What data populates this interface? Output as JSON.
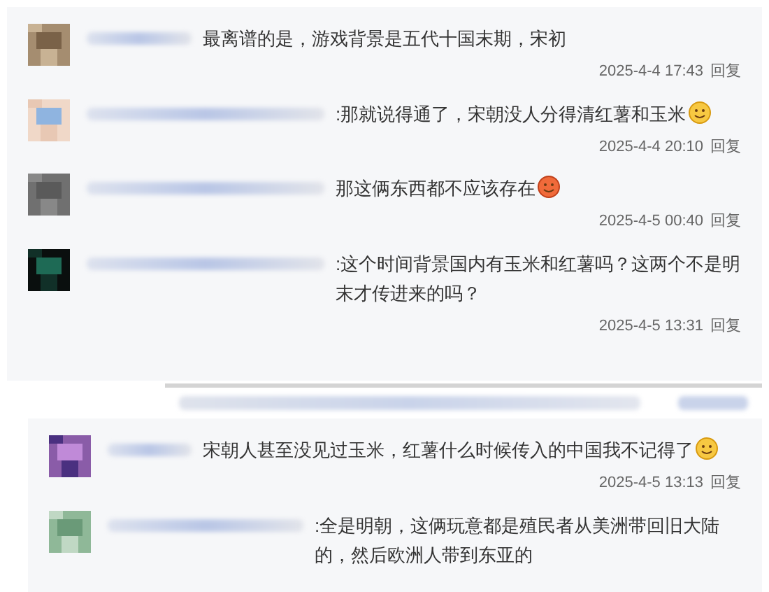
{
  "sections": [
    {
      "comments": [
        {
          "text": "最离谱的是，游戏背景是五代十国末期，宋初",
          "time": "2025-4-4 17:43",
          "reply": "回复"
        },
        {
          "text": ":那就说得通了，宋朝没人分得清红薯和玉米",
          "emoji": {
            "kind": "smile"
          },
          "time": "2025-4-4 20:10",
          "reply": "回复"
        },
        {
          "text": "那这俩东西都不应该存在",
          "emoji": {
            "kind": "angry"
          },
          "time": "2025-4-5 00:40",
          "reply": "回复"
        },
        {
          "text": ":这个时间背景国内有玉米和红薯吗？这两个不是明末才传进来的吗？",
          "time": "2025-4-5 13:31",
          "reply": "回复"
        }
      ]
    },
    {
      "comments": [
        {
          "text": "宋朝人甚至没见过玉米，红薯什么时候传入的中国我不记得了",
          "emoji": {
            "kind": "smile"
          },
          "time": "2025-4-5 13:13",
          "reply": "回复"
        },
        {
          "text": ":全是明朝，这俩玩意都是殖民者从美洲带回旧大陆的，然后欧洲人带到东亚的"
        }
      ]
    }
  ]
}
